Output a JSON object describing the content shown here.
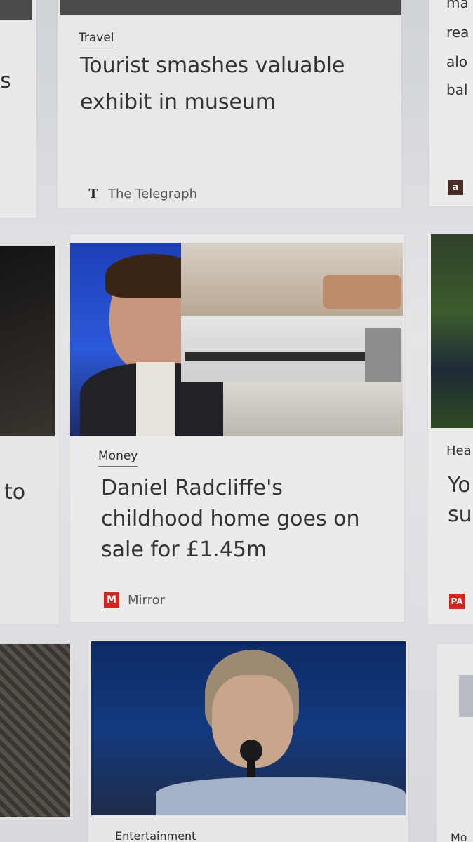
{
  "cards": {
    "travel": {
      "category": "Travel",
      "headline_line1": "Tourist smashes valuable",
      "headline_line2": "exhibit in museum",
      "source": "The Telegraph",
      "logo_glyph": "T"
    },
    "money": {
      "category": "Money",
      "headline_line1": "Daniel Radcliffe's",
      "headline_line2": "childhood home goes on",
      "headline_line3": "sale for £1.45m",
      "source": "Mirror",
      "logo_glyph": "M"
    },
    "entertainment": {
      "category": "Entertainment"
    }
  },
  "partial": {
    "left_top": "s",
    "left_mid": "to",
    "right_top_line1": "ma",
    "right_top_line2": "rea",
    "right_top_line3": "alo",
    "right_top_line4": "bal",
    "right_top_logo": "a",
    "right_mid_category": "Hea",
    "right_mid_line1": "Yo",
    "right_mid_line2": "su",
    "right_mid_logo": "PA",
    "right_bottom_category": "Mo"
  },
  "colors": {
    "mirror_red": "#d3251e",
    "tile_bg": "#ececec",
    "text": "#333333"
  }
}
